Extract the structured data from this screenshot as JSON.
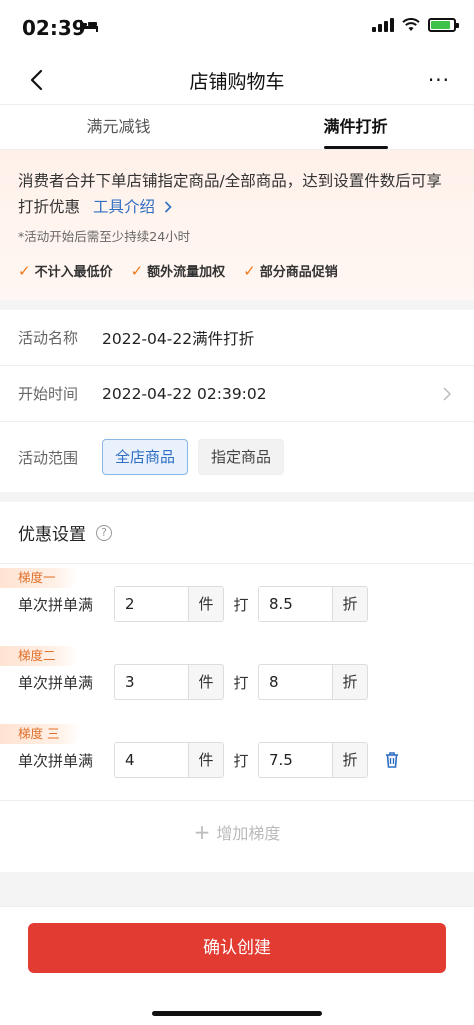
{
  "status_bar": {
    "time": "02:39",
    "battery_level": 0.85,
    "battery_color": "#3ec24a"
  },
  "nav": {
    "title": "店铺购物车",
    "back_icon": "chevron-left-icon",
    "more_label": "···"
  },
  "tabs": [
    {
      "label": "满元减钱",
      "active": false
    },
    {
      "label": "满件打折",
      "active": true
    }
  ],
  "info": {
    "description": "消费者合并下单店铺指定商品/全部商品，达到设置件数后可享打折优惠",
    "link_label": "工具介绍",
    "note": "*活动开始后需至少持续24小时",
    "perks": [
      "不计入最低价",
      "额外流量加权",
      "部分商品促销"
    ]
  },
  "form": {
    "name_label": "活动名称",
    "name_value": "2022-04-22满件打折",
    "start_label": "开始时间",
    "start_value": "2022-04-22 02:39:02",
    "scope_label": "活动范围",
    "scope_options": [
      "全店商品",
      "指定商品"
    ],
    "scope_selected": "全店商品"
  },
  "discount": {
    "section_title": "优惠设置",
    "tiers": [
      {
        "tag": "梯度一",
        "label": "单次拼单满",
        "count": "2",
        "count_unit": "件",
        "da": "打",
        "rate": "8.5",
        "rate_unit": "折",
        "deletable": false
      },
      {
        "tag": "梯度二",
        "label": "单次拼单满",
        "count": "3",
        "count_unit": "件",
        "da": "打",
        "rate": "8",
        "rate_unit": "折",
        "deletable": false
      },
      {
        "tag": "梯度 三",
        "label": "单次拼单满",
        "count": "4",
        "count_unit": "件",
        "da": "打",
        "rate": "7.5",
        "rate_unit": "折",
        "deletable": true
      }
    ],
    "add_tier_label": "增加梯度"
  },
  "confirm_button": "确认创建",
  "colors": {
    "accent": "#e23b32",
    "link": "#2f6ec3",
    "tag": "#e0702a"
  }
}
